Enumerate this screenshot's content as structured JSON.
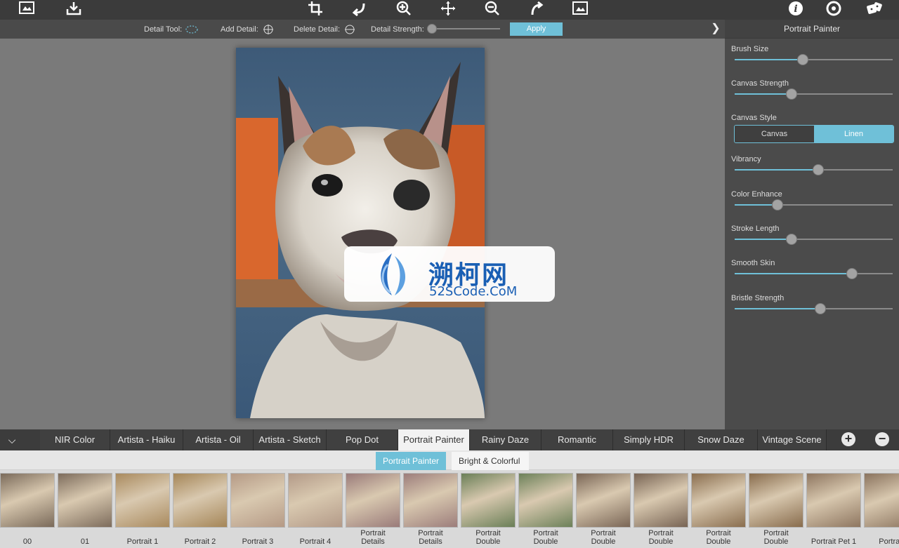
{
  "detail_bar": {
    "detail_tool": "Detail Tool:",
    "add_detail": "Add Detail:",
    "delete_detail": "Delete Detail:",
    "detail_strength": "Detail Strength:",
    "apply": "Apply",
    "detail_strength_value": 0.0
  },
  "panel": {
    "title": "Portrait Painter",
    "sliders": [
      {
        "label": "Brush Size",
        "value": 0.43
      },
      {
        "label": "Canvas Strength",
        "value": 0.36
      },
      {
        "label": "Vibrancy",
        "value": 0.53
      },
      {
        "label": "Color Enhance",
        "value": 0.27
      },
      {
        "label": "Stroke Length",
        "value": 0.36
      },
      {
        "label": "Smooth Skin",
        "value": 0.74
      },
      {
        "label": "Bristle Strength",
        "value": 0.54
      }
    ],
    "canvas_style": {
      "label": "Canvas Style",
      "options": [
        "Canvas",
        "Linen"
      ],
      "selected": "Linen"
    }
  },
  "watermark": {
    "cn": "溯柯网",
    "en": "52SCode.CoM"
  },
  "tabs": [
    "NIR Color",
    "Artista - Haiku",
    "Artista - Oil",
    "Artista - Sketch",
    "Pop Dot",
    "Portrait Painter",
    "Rainy Daze",
    "Romantic",
    "Simply HDR",
    "Snow Daze",
    "Vintage Scene"
  ],
  "active_tab": "Portrait Painter",
  "subtabs": [
    "Portrait Painter",
    "Bright & Colorful"
  ],
  "active_subtab": "Portrait Painter",
  "thumbnails": [
    {
      "label": "00",
      "color": "#7a6a5a"
    },
    {
      "label": "01",
      "color": "#7d6c5c"
    },
    {
      "label": "Portrait 1",
      "color": "#a98a5e"
    },
    {
      "label": "Portrait 2",
      "color": "#a58658"
    },
    {
      "label": "Portrait 3",
      "color": "#b59a86"
    },
    {
      "label": "Portrait 4",
      "color": "#b39a88"
    },
    {
      "label": "Portrait Details",
      "color": "#9a7b7a"
    },
    {
      "label": "Portrait Details",
      "color": "#9c7d7b"
    },
    {
      "label": "Portrait Double",
      "color": "#6a7f57"
    },
    {
      "label": "Portrait Double",
      "color": "#6c8159"
    },
    {
      "label": "Portrait Double",
      "color": "#7a6656"
    },
    {
      "label": "Portrait Double",
      "color": "#786454"
    },
    {
      "label": "Portrait Double",
      "color": "#8a6e4f"
    },
    {
      "label": "Portrait Double",
      "color": "#886c4d"
    },
    {
      "label": "Portrait Pet 1",
      "color": "#8e7660"
    },
    {
      "label": "Portrait",
      "color": "#8a735e"
    }
  ],
  "colors": {
    "accent": "#6fc0d8"
  }
}
